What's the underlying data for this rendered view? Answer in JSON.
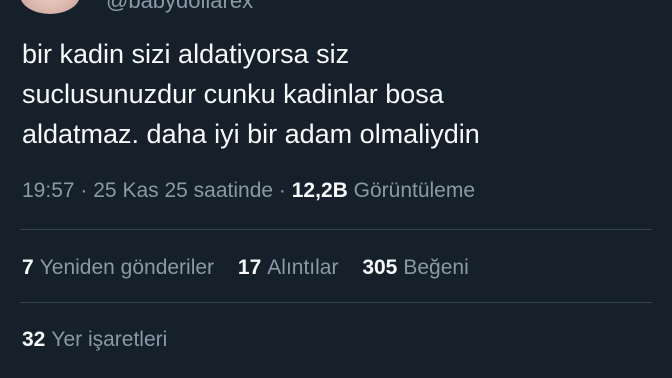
{
  "author": {
    "handle": "@babydollarex"
  },
  "tweet": {
    "lines": [
      "bir kadin sizi aldatiyorsa siz",
      "suclusunuzdur cunku kadinlar bosa",
      "aldatmaz. daha iyi bir adam olmaliydin"
    ]
  },
  "meta": {
    "time": "19:57",
    "separator": "·",
    "date": "25 Kas 25 saatinde",
    "views_count": "12,2B",
    "views_label": "Görüntüleme"
  },
  "stats": {
    "reposts": {
      "count": "7",
      "label": "Yeniden gönderiler"
    },
    "quotes": {
      "count": "17",
      "label": "Alıntılar"
    },
    "likes": {
      "count": "305",
      "label": "Beğeni"
    },
    "bookmarks": {
      "count": "32",
      "label": "Yer işaretleri"
    }
  },
  "colors": {
    "background": "#15202b",
    "primary_text": "#f7f9f9",
    "secondary_text": "#8b98a5",
    "divider": "#38444d"
  }
}
